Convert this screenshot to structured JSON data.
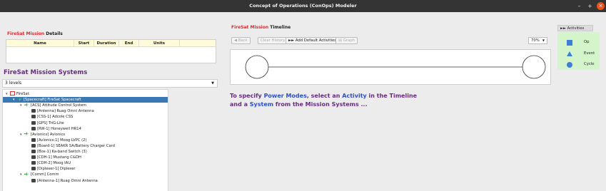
{
  "window": {
    "title": "Concept of Operations (ConOps) Modeler"
  },
  "details": {
    "title_prefix": "FireSat Mission",
    "title_suffix": " Details",
    "columns": [
      "Name",
      "Start",
      "Duration",
      "End",
      "Units"
    ]
  },
  "systems": {
    "title": "FireSat Mission Systems",
    "levels_value": "3 levels",
    "tree": [
      {
        "label": "FireSat",
        "indent": 0,
        "icon": "root-icon",
        "toggle": "▾",
        "selected": false
      },
      {
        "label": "[Spacecraft] FireSat Spacecraft",
        "indent": 1,
        "icon": "satellite-icon",
        "toggle": "▾",
        "selected": true
      },
      {
        "label": "[ACS] Attitude Control System",
        "indent": 2,
        "icon": "satellite-icon",
        "toggle": "▾",
        "selected": false
      },
      {
        "label": "[Antenna] Ruag Omni Antenna",
        "indent": 3,
        "icon": "device-icon",
        "toggle": "",
        "selected": false
      },
      {
        "label": "[CSS-1] Adcole CSS",
        "indent": 3,
        "icon": "device-icon",
        "toggle": "",
        "selected": false
      },
      {
        "label": "[GPS] TriG-Lite",
        "indent": 3,
        "icon": "device-icon",
        "toggle": "",
        "selected": false
      },
      {
        "label": "[RW-1] Honeywell HR14",
        "indent": 3,
        "icon": "device-icon",
        "toggle": "",
        "selected": false
      },
      {
        "label": "[Avionics] Avionics",
        "indent": 2,
        "icon": "satellite-icon",
        "toggle": "▾",
        "selected": false
      },
      {
        "label": "[Avionics-1] Moog LVPC (2)",
        "indent": 3,
        "icon": "device-icon",
        "toggle": "",
        "selected": false
      },
      {
        "label": "[Board-1] SEAKR SA/Battery Charger Card",
        "indent": 3,
        "icon": "device-icon",
        "toggle": "",
        "selected": false
      },
      {
        "label": "[Box-1] Ka-band Switch (3)",
        "indent": 3,
        "icon": "device-icon",
        "toggle": "",
        "selected": false
      },
      {
        "label": "[CDH-1] Mustang C&DH",
        "indent": 3,
        "icon": "device-icon",
        "toggle": "",
        "selected": false
      },
      {
        "label": "[CDH-2] Moog IAU",
        "indent": 3,
        "icon": "device-icon",
        "toggle": "",
        "selected": false
      },
      {
        "label": "[Diplexer-1] Diplexer",
        "indent": 3,
        "icon": "device-icon",
        "toggle": "",
        "selected": false
      },
      {
        "label": "[Comm] Comm",
        "indent": 2,
        "icon": "satellite-icon",
        "toggle": "▾",
        "selected": false
      },
      {
        "label": "[Antenna-1] Ruag Omni Antenna",
        "indent": 3,
        "icon": "device-icon",
        "toggle": "",
        "selected": false
      }
    ]
  },
  "timeline": {
    "title_prefix": "FireSat Mission",
    "title_suffix": " Timeline",
    "back_label": "Back",
    "clear_history_label": "Clear History",
    "add_default_label": "Add Default Activities",
    "graph_label": "Graph",
    "zoom_value": "70%"
  },
  "prompt": {
    "l1a": "To specify ",
    "l1b": "Power Modes",
    "l1c": ", select an ",
    "l1d": "Activity",
    "l1e": " in the Timeline",
    "l2a": "and a ",
    "l2b": "System",
    "l2c": " from the Mission Systems ..."
  },
  "palette": {
    "tab_label": "Activities",
    "items": [
      {
        "label": "Op",
        "shape": "square-icon"
      },
      {
        "label": "Event",
        "shape": "triangle-icon"
      },
      {
        "label": "Cycle",
        "shape": "circle-icon"
      }
    ]
  },
  "colors": {
    "accent_red": "#e8262e",
    "purple": "#6a2a86",
    "blue": "#2b4fd3",
    "palette_bg": "#d4f5c9",
    "selection": "#3a78b4"
  }
}
